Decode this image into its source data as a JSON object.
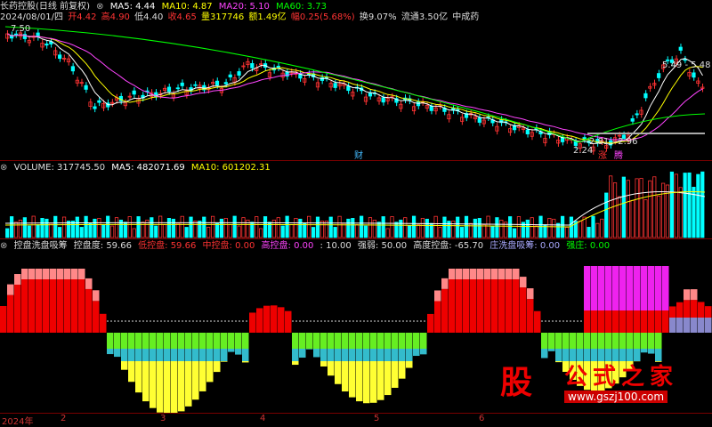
{
  "price_header": {
    "stock": "长药控股(日线 前复权)",
    "ma5": "MA5: 4.44",
    "ma10": "MA10: 4.87",
    "ma20": "MA20: 5.10",
    "ma60": "MA60: 3.73"
  },
  "price_info": {
    "date": "2024/08/01/四",
    "open": "开4.42",
    "high": "高4.90",
    "low": "低4.40",
    "close": "收4.65",
    "volume": "量317746",
    "amount": "额1.49亿",
    "change": "幅0.25(5.68%)",
    "turnover": "换9.07%",
    "float": "流通3.50亿",
    "sector": "中成药"
  },
  "price_labels": {
    "high_left": "7.50",
    "range_high": "5.49 - 5.48",
    "range_low": "2.81 - 2.96",
    "low": "2.24",
    "cai": "财",
    "zhang": "涨",
    "teng": "腾"
  },
  "volume_header": {
    "name": "VOLUME: 317745.50",
    "ma5": "MA5: 482071.69",
    "ma10": "MA10: 601202.31"
  },
  "indicator_header": {
    "name": "控盘洗盘吸筹",
    "kongpan": "控盘度: 59.66",
    "dikongpan": "低控盘: 59.66",
    "zhongkongpan": "中控盘: 0.00",
    "gaokongpan": "高控盘: 0.00",
    "ten": ": 10.00",
    "qiangruo": "强弱: 50.00",
    "gaodu": "高度控盘: -65.70",
    "zhuang": "庄洗盘吸筹: 0.00",
    "qiangzhuang": "强庄: 0.00"
  },
  "x_axis": [
    "2024年",
    "2",
    "3",
    "4",
    "5",
    "6"
  ],
  "watermark": {
    "char": "股",
    "text": "公式之家",
    "url": "www.gszj100.com"
  },
  "colors": {
    "up": "#ff3333",
    "down": "#00ffff",
    "ma5": "#ffffff",
    "ma10": "#ffff00",
    "ma20": "#ff44ff",
    "ma60": "#00ff00",
    "red_bar": "#ee0000",
    "pink_bar": "#ff8888",
    "magenta_bar": "#ee22ee",
    "yellow_bar": "#ffff33",
    "cyan_bar": "#33bbcc",
    "green_bar": "#66ee22",
    "purple_bar": "#8888cc"
  }
}
